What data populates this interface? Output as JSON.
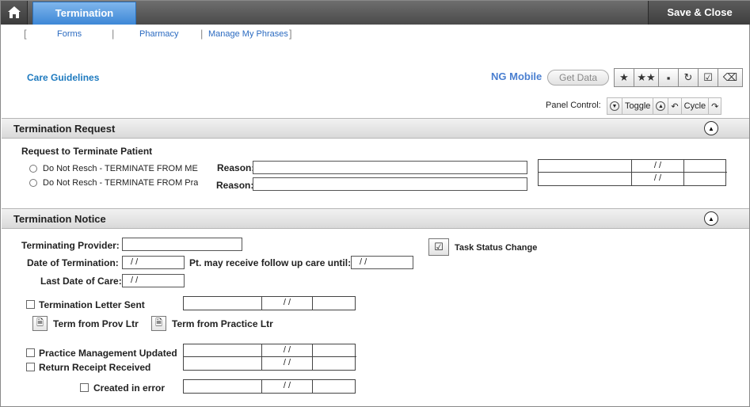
{
  "topbar": {
    "tab_label": "Termination",
    "save_close": "Save & Close"
  },
  "links": [
    "Forms",
    "Pharmacy",
    "Manage My Phrases"
  ],
  "care_guidelines": "Care Guidelines",
  "ng_mobile": {
    "label": "NG Mobile",
    "get_data": "Get Data"
  },
  "panel_control": {
    "label": "Panel Control:",
    "toggle": "Toggle",
    "cycle": "Cycle"
  },
  "termination_request": {
    "title": "Termination Request",
    "subtitle": "Request to Terminate Patient",
    "options": [
      "Do Not Resch - TERMINATE FROM ME",
      "Do Not Resch - TERMINATE FROM Prac"
    ],
    "reason_label": "Reason:",
    "date_placeholder": "/ /"
  },
  "termination_notice": {
    "title": "Termination Notice",
    "terminating_provider_label": "Terminating Provider:",
    "date_of_termination_label": "Date of Termination:",
    "date_of_termination_value": "/ /",
    "follow_up_label": "Pt. may receive follow up care until:",
    "follow_up_value": "/ /",
    "last_date_label": "Last Date of Care:",
    "last_date_value": "/ /",
    "task_status_change": "Task Status Change",
    "letter_sent_label": "Termination Letter Sent",
    "term_prov_ltr": "Term from Prov Ltr",
    "term_practice_ltr": "Term from Practice Ltr",
    "pm_updated_label": "Practice Management Updated",
    "return_receipt_label": "Return Receipt Received",
    "created_error_label": "Created in error",
    "date_placeholder": "/ /"
  }
}
